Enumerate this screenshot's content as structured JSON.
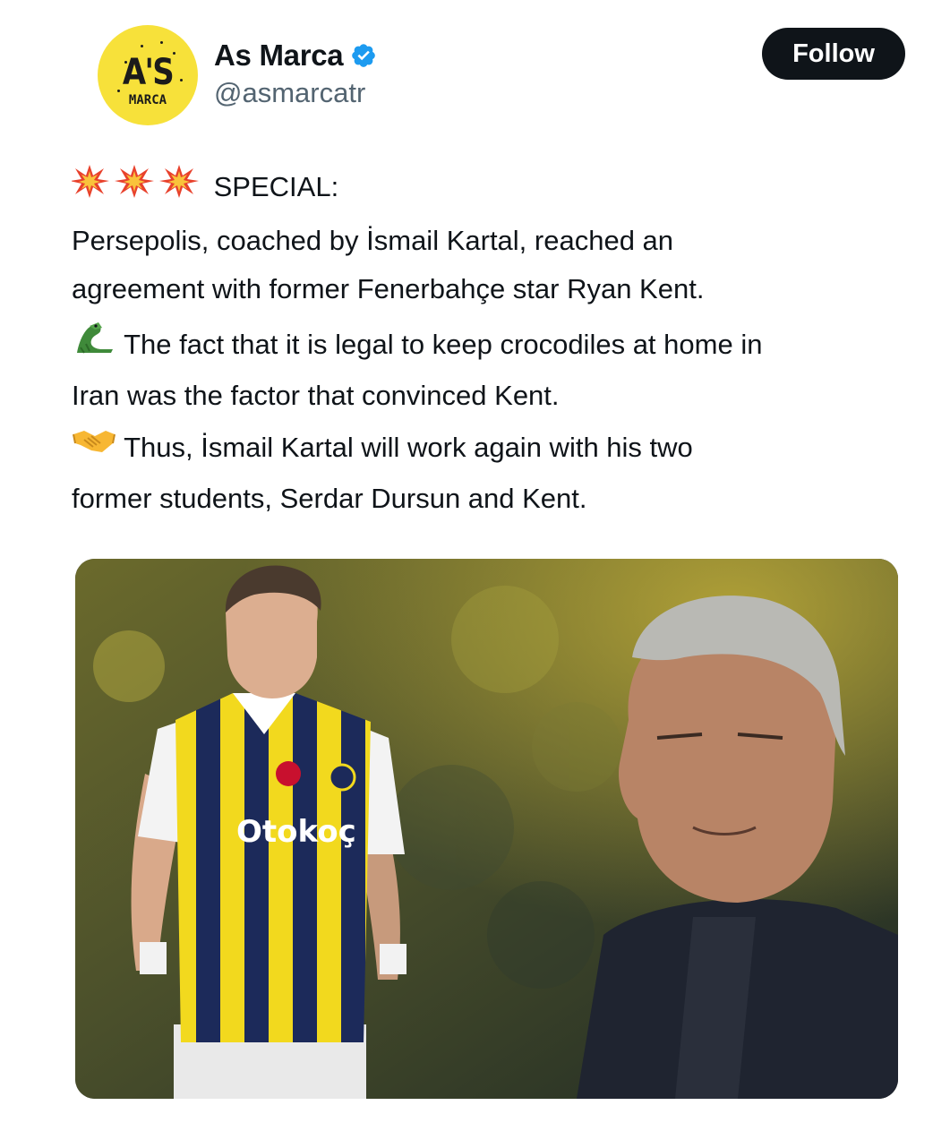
{
  "author": {
    "display_name": "As Marca",
    "handle": "@asmarcatr",
    "avatar_text_top": "A'S",
    "avatar_text_bottom": "MARCA",
    "verified": true
  },
  "follow_label": "Follow",
  "tweet": {
    "header_line": "SPECIAL:",
    "paragraph1_lines": [
      "Persepolis, coached by İsmail Kartal, reached an",
      "agreement with former Fenerbahçe star Ryan Kent."
    ],
    "paragraph2_lines": [
      "The fact that it is legal to keep crocodiles at home in",
      "Iran was the factor that convinced Kent."
    ],
    "paragraph3_lines": [
      "Thus, İsmail Kartal will work again with his two",
      "former students, Serdar Dursun and Kent."
    ]
  },
  "media": {
    "shirt_sponsor": "Otokoç"
  },
  "colors": {
    "accent_black": "#0f1419",
    "secondary_text": "#536471",
    "verified_blue": "#1d9bf0",
    "avatar_yellow": "#f7e13a"
  },
  "icons": [
    "verified-badge-icon",
    "collision-emoji-icon",
    "crocodile-emoji-icon",
    "handshake-emoji-icon"
  ]
}
